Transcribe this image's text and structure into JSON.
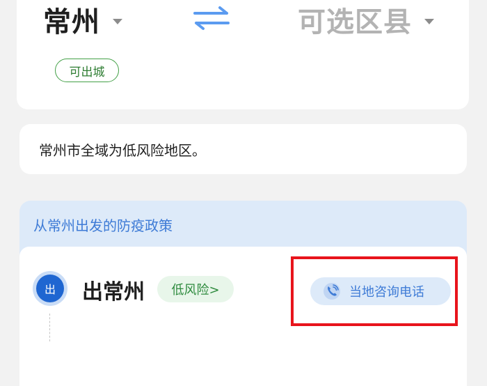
{
  "route": {
    "origin": "常州",
    "destination": "可选区县",
    "origin_tag": "可出城"
  },
  "notice": {
    "text": "常州市全域为低风险地区。"
  },
  "policy": {
    "title": "从常州出发的防疫政策",
    "outbound": {
      "badge": "出",
      "title": "出常州",
      "risk_label": "低风险>",
      "hotline_label": "当地咨询电话"
    }
  },
  "colors": {
    "accent_blue": "#3e7bd6",
    "badge_blue": "#1f66d1",
    "green_tag": "#43a047",
    "highlight_red": "#e8141c"
  },
  "icons": [
    "dropdown-caret-icon",
    "swap-icon",
    "phone-icon"
  ]
}
